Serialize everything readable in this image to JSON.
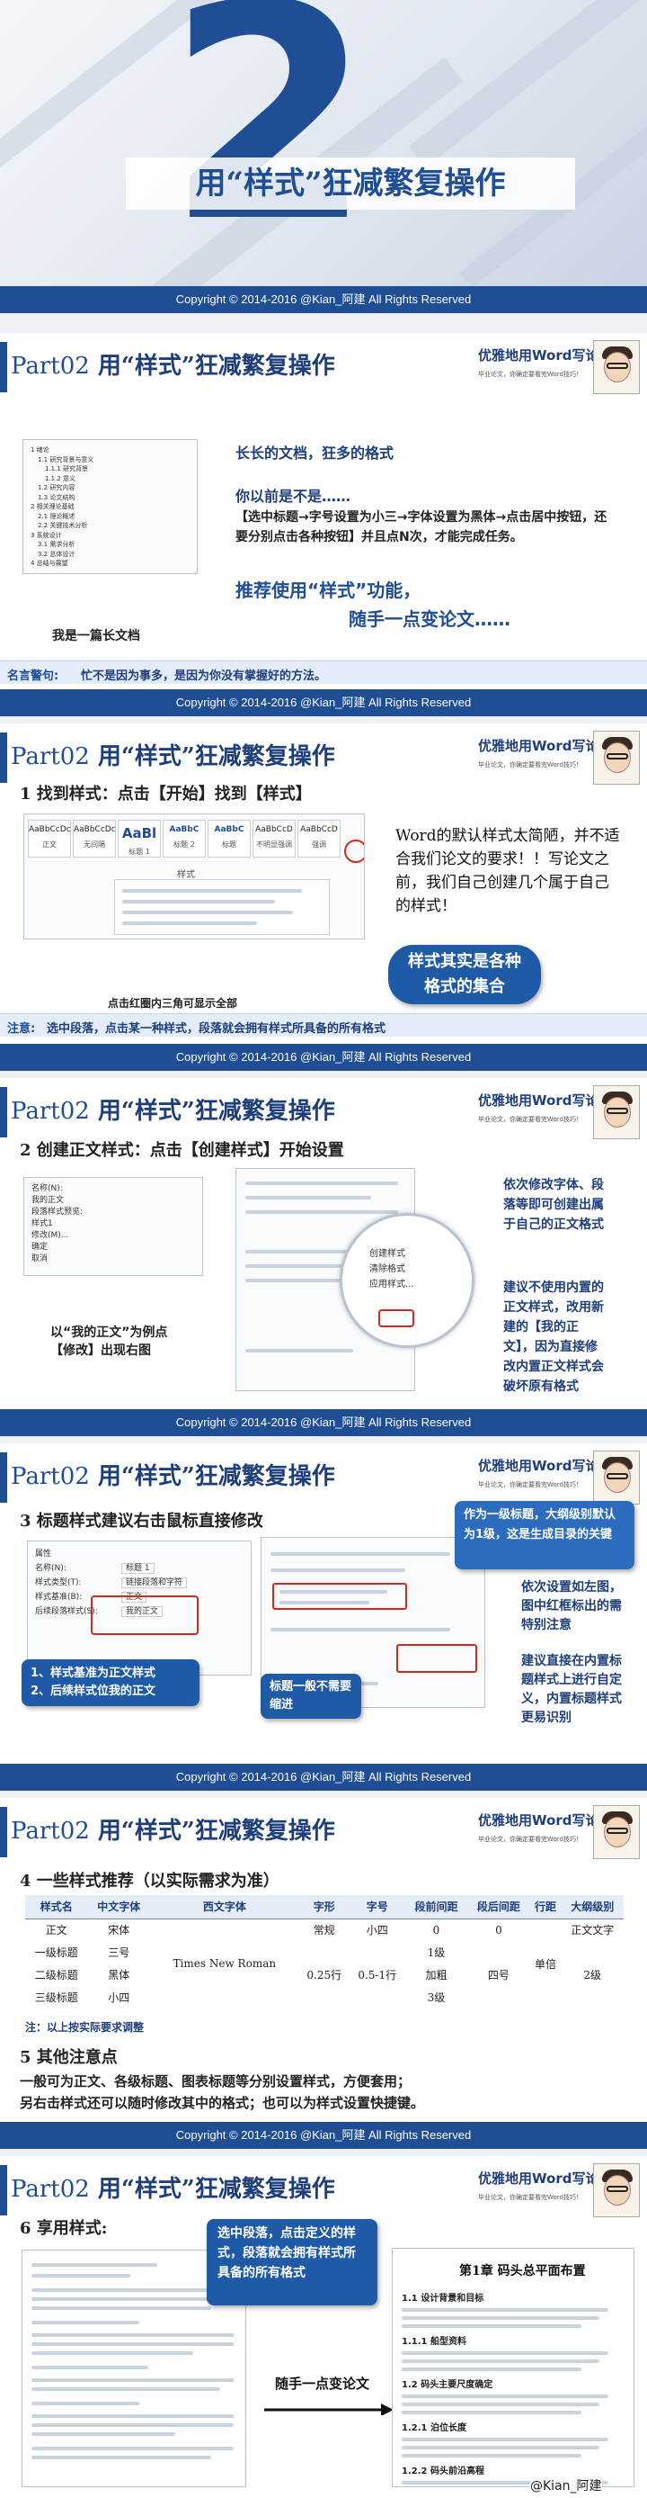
{
  "cover": {
    "number": "2",
    "title": "用“样式”狂减繁复操作"
  },
  "copyright": "Copyright © 2014-2016 @Kian_阿建 All Rights Reserved",
  "slide_header": {
    "prefix": "Part02",
    "title": "用“样式”狂减繁复操作",
    "brand": "优雅地用Word写论文",
    "brand_sub": "毕业论文，你确定要看完Word技巧！"
  },
  "slide1": {
    "toc_caption": "我是一篇长文档",
    "toc_lines": [
      "1 绪论",
      "1.1 研究背景与意义",
      "1.1.1 研究背景",
      "1.1.2 意义",
      "1.2 研究内容",
      "1.3 论文结构",
      "2 相关理论基础",
      "2.1 理论概述",
      "2.2 关键技术分析",
      "3 系统设计",
      "3.1 需求分析",
      "3.2 总体设计",
      "4 总结与展望"
    ],
    "l1": "长长的文档，狂多的格式",
    "l2": "你以前是不是……",
    "l3": "【选中标题→字号设置为小三→字体设置为黑体→点击居中按钮，还要分别点击各种按钮】并且点N次，才能完成任务。",
    "l4": "推荐使用“样式”功能，",
    "l5": "随手一点变论文……",
    "note_key": "名言警句:",
    "note": "忙不是因为事多，是因为你没有掌握好的方法。"
  },
  "slide2": {
    "heading": "1 找到样式：点击【开始】找到【样式】",
    "styles": [
      "AaBbCcDc",
      "AaBbCcDc",
      "AaBl",
      "AaBbC",
      "AaBbC",
      "AaBbCcD",
      "AaBbCcD"
    ],
    "style_names": [
      "正文",
      "无间隔",
      "标题 1",
      "标题 2",
      "标题",
      "不明显强调",
      "强调"
    ],
    "panel_label": "样式",
    "caption": "点击红圈内三角可显示全部",
    "p1": "Word的默认样式太简陋，并不适合我们论文的要求！！写论文之前，我们自己创建几个属于自己的样式！",
    "bubble": "样式其实是各种格式的集合",
    "note_key": "注意:",
    "note": "选中段落，点击某一种样式，段落就会拥有样式所具备的所有格式"
  },
  "slide3": {
    "heading": "2 创建正文样式：点击【创建样式】开始设置",
    "dialog_lines": [
      "名称(N):",
      "我的正文",
      "段落样式预览:",
      "样式1",
      "修改(M)...",
      "确定",
      "取消"
    ],
    "caption1": "以“我的正文”为例点",
    "caption2": "【修改】出现右图",
    "menu_items": [
      "创建样式",
      "清除格式",
      "应用样式..."
    ],
    "p1": "依次修改字体、段落等即可创建出属于自己的正文格式",
    "p2": "建议不使用内置的正文样式，改用新建的【我的正文】，因为直接修改内置正文样式会破坏原有格式"
  },
  "slide4": {
    "heading": "3 标题样式建议右击鼠标直接修改",
    "bubble_top": "作为一级标题，大纲级别默认为1级，这是生成目录的关键",
    "bubble_left1": "1、样式基准为正文样式",
    "bubble_left2": "2、后续样式位我的正文",
    "bubble_mid": "标题一般不需要缩进",
    "p1": "依次设置如左图，图中红框标出的需特别注意",
    "p2": "建议直接在内置标题样式上进行自定义，内置标题样式更易识别",
    "form_labels": [
      "属性",
      "名称(N):",
      "样式类型(T):",
      "样式基准(B):",
      "后续段落样式(S):",
      "段落",
      "常规",
      "对齐方式(G):",
      "大纲级别(O):",
      "缩进",
      "左侧(L):",
      "右侧(R):",
      "特殊格式(S):"
    ],
    "form_values": [
      "标题 1",
      "链接段落和字符",
      "正文",
      "我的正文",
      "两端对齐",
      "1 级",
      "0 字符",
      "0 字符",
      "(无)"
    ]
  },
  "slide5": {
    "heading": "4 一些样式推荐（以实际需求为准）",
    "table_headers": [
      "样式名",
      "中文字体",
      "西文字体",
      "字形",
      "字号",
      "段前间距",
      "段后间距",
      "行距",
      "大纲级别"
    ],
    "rows": [
      [
        "正文",
        "宋体",
        "",
        "常规",
        "小四",
        "0",
        "0",
        "",
        "正文文字"
      ],
      [
        "一级标题",
        "",
        "",
        "",
        "三号",
        "",
        "",
        "",
        "1级"
      ],
      [
        "二级标题",
        "黑体",
        "",
        "加粗",
        "四号",
        "",
        "",
        "",
        "2级"
      ],
      [
        "三级标题",
        "",
        "",
        "",
        "小四",
        "0",
        "0",
        "",
        "3级"
      ]
    ],
    "merged_font": "Times New Roman",
    "merged_spacing_before": "0.25行",
    "merged_spacing_after": "0.5-1行",
    "merged_line": "单倍",
    "table_note": "注：以上按实际要求调整",
    "heading2": "5 其他注意点",
    "p1": "一般可为正文、各级标题、图表标题等分别设置样式，方便套用；",
    "p2": "另右击样式还可以随时修改其中的格式；也可以为样式设置快捷键。"
  },
  "slide6": {
    "heading": "6 享用样式:",
    "bubble": "选中段落，点击定义的样式，段落就会拥有样式所具备的所有格式",
    "arrow_label": "随手一点变论文",
    "right_title": "第1章 码头总平面布置",
    "right_lines": [
      "1.1 设计背景和目标",
      "1.1.1 船型资料",
      "1.2 码头主要尺度确定",
      "1.2.1 泊位长度",
      "1.2.2 码头前沿高程"
    ],
    "watermark": "@Kian_阿建"
  },
  "colors": {
    "accent": "#1f4e94",
    "highlight": "#d7261e",
    "bubble": "#1f5aa6"
  }
}
